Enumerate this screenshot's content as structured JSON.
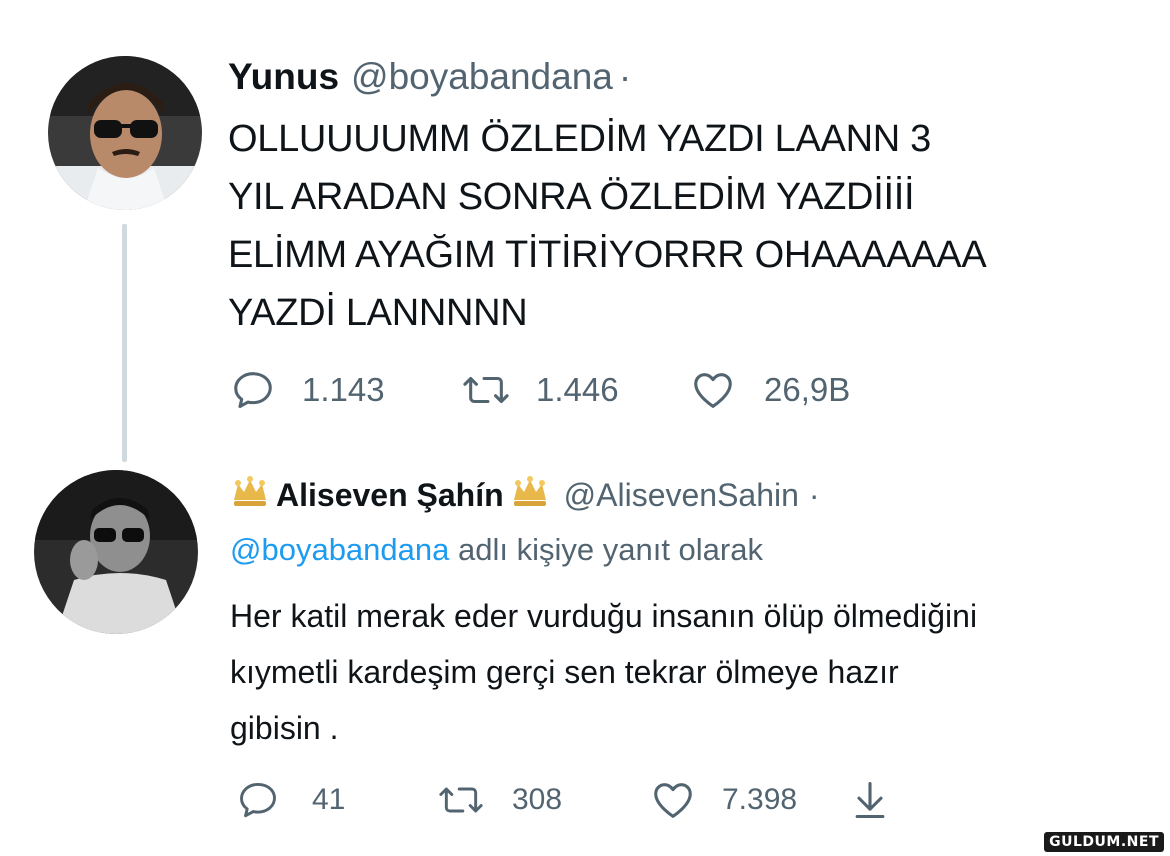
{
  "tweet1": {
    "display_name": "Yunus",
    "handle": "@boyabandana",
    "separator": "·",
    "text_lines": [
      "OLLUUUUMM ÖZLEDİM YAZDI LAANN 3",
      "YIL ARADAN SONRA ÖZLEDİM YAZDİİİİ",
      "ELİMM AYAĞIM TİTİRİYORRR OHAAAAAAA",
      "YAZDİ LANNNNN"
    ],
    "replies": "1.143",
    "retweets": "1.446",
    "likes": "26,9B"
  },
  "tweet2": {
    "display_name": "Aliseven Şahín",
    "handle": "@AlisevenSahin",
    "separator": "·",
    "reply_to_mention": "@boyabandana",
    "reply_to_suffix": " adlı kişiye yanıt olarak",
    "text_lines": [
      "Her katil merak eder vurduğu insanın ölüp ölmediğini",
      "kıymetli kardeşim gerçi sen tekrar ölmeye hazır",
      "gibisin ."
    ],
    "replies": "41",
    "retweets": "308",
    "likes": "7.398"
  },
  "icons": {
    "reply": "reply-icon",
    "retweet": "retweet-icon",
    "like": "heart-icon",
    "share": "share-icon",
    "badge": "crown-emoji-icon"
  },
  "colors": {
    "text": "#0f1419",
    "secondary": "#536471",
    "mention": "#1d9bf0",
    "thread_line": "#cfd9de",
    "crown": "#e8b84a"
  },
  "watermark": "GULDUM.NET"
}
